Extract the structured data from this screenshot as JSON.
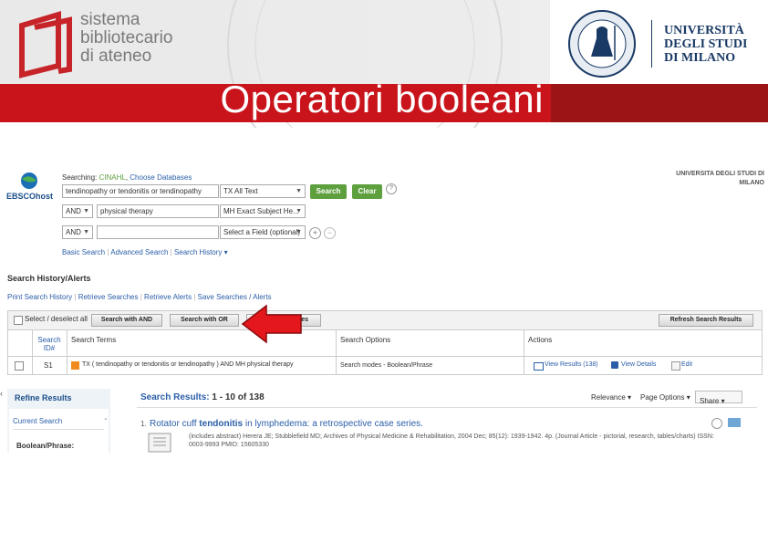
{
  "header": {
    "logo_lines": [
      "sistema",
      "bibliotecario",
      "di ateneo"
    ],
    "university_lines": [
      "UNIVERSITÀ",
      "DEGLI STUDI",
      "DI MILANO"
    ],
    "seal_text": "UNIVERSITAS STUDIORUM MEDIOLANENSIS",
    "slide_title": "Operatori booleani",
    "banner_color": "#c9141c"
  },
  "ebsco": {
    "logo_text": "EBSCOhost",
    "searching_label": "Searching:",
    "database": "CINAHL",
    "choose_databases": "Choose Databases",
    "institution_line1": "UNIVERSITA DEGLI STUDI DI",
    "institution_line2": "MILANO",
    "rows": [
      {
        "operator": "",
        "term": "tendinopathy or tendonitis or tendinopathy",
        "field": "TX All Text"
      },
      {
        "operator": "AND",
        "term": "physical therapy",
        "field": "MH Exact Subject He..."
      },
      {
        "operator": "AND",
        "term": "",
        "field": "Select a Field (optional)"
      }
    ],
    "search_button": "Search",
    "clear_button": "Clear",
    "help_icon": "?",
    "links": [
      "Basic Search",
      "Advanced Search",
      "Search History ▾"
    ]
  },
  "history": {
    "title": "Search History/Alerts",
    "links": [
      "Print Search History",
      "Retrieve Searches",
      "Retrieve Alerts",
      "Save Searches / Alerts"
    ],
    "select_label": "Select / deselect all",
    "search_with_and": "Search with AND",
    "search_with_or": "Search with OR",
    "delete_searches": "Delete Searches",
    "refresh_results": "Refresh Search Results",
    "columns": [
      "Search ID#",
      "Search Terms",
      "Search Options",
      "Actions"
    ],
    "row": {
      "id": "S1",
      "terms": "TX ( tendinopathy or tendonitis or tendinopathy ) AND MH physical therapy",
      "options": "Search modes - Boolean/Phrase",
      "view_results": "View Results (138)",
      "view_details": "View Details",
      "edit": "Edit"
    }
  },
  "results": {
    "refine_title": "Refine Results",
    "current_search": "Current Search",
    "boolean_phrase": "Boolean/Phrase:",
    "results_label": "Search Results:",
    "results_range": "1 - 10 of 138",
    "relevance": "Relevance ▾",
    "page_options": "Page Options ▾",
    "share": "Share ▾",
    "first_result_number": "1.",
    "first_result_title_pre": "Rotator cuff ",
    "first_result_title_bold": "tendonitis",
    "first_result_title_post": " in lymphedema: a retrospective case series.",
    "first_result_line1": "(includes abstract) Herera JE; Stubblefield MD; Archives of Physical Medicine & Rehabilitation, 2004 Dec; 85(12): 1939-1942. 4p. (Journal Article - pictorial, research, tables/charts) ISSN:",
    "first_result_line2": "0003-9993 PMID: 15605330"
  },
  "colors": {
    "ebsco_green": "#5ea03e",
    "link_blue": "#2a5ea8",
    "arrow_red": "#e4181c",
    "accent_red": "#9b1416"
  }
}
